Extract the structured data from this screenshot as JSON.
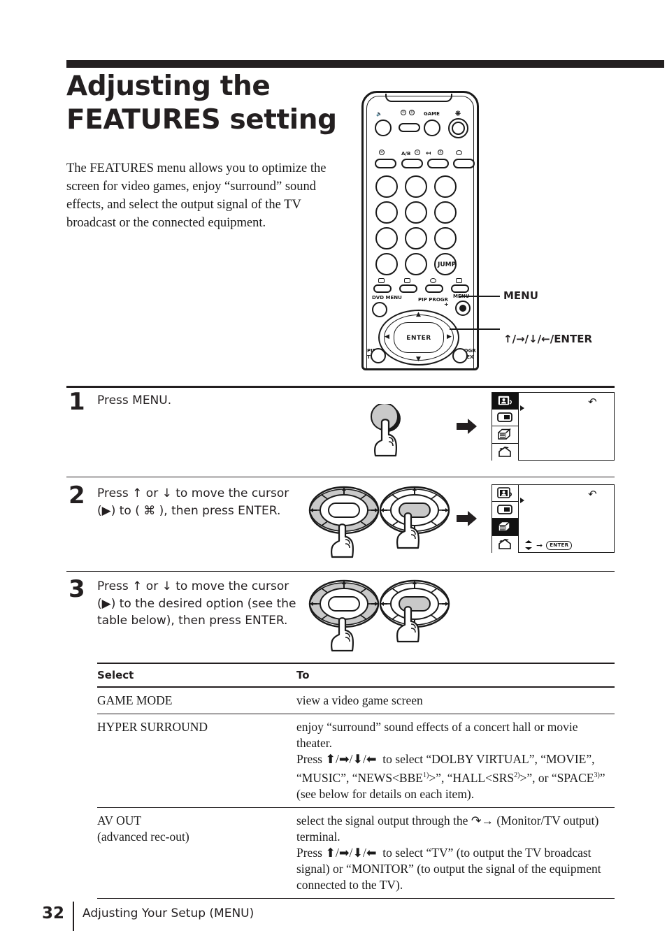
{
  "page": {
    "number": "32",
    "footer_section": "Adjusting Your Setup (MENU)"
  },
  "header": {
    "title_line1": "Adjusting the",
    "title_line2": "FEATURES setting",
    "intro": "The FEATURES menu allows you to optimize the screen for video games, enjoy “surround” sound effects, and select the output signal of the TV broadcast or the connected equipment."
  },
  "remote": {
    "labels": {
      "game": "GAME",
      "ab": "A/B",
      "dvd_menu": "DVD MENU",
      "pip_progr": "PIP PROGR",
      "menu": "MENU",
      "pip_text_1": "PIP",
      "pip_text_2": "TEXT",
      "progr_index_1": "PROGR",
      "progr_index_2": "INDEX",
      "jump": "JUMP",
      "enter": "ENTER",
      "plus": "+",
      "minus": "–"
    },
    "callouts": [
      {
        "name": "menu-callout",
        "text": "MENU"
      },
      {
        "name": "direction-enter-callout",
        "text": "↑/→/↓/←/ENTER"
      }
    ]
  },
  "steps": [
    {
      "number": "1",
      "text": "Press MENU."
    },
    {
      "number": "2",
      "text_parts": [
        "Press ",
        " or ",
        " to move the cursor (",
        ") to (",
        "),  then press ENTER."
      ],
      "text_plain": "Press ↑ or ↓ to move the cursor (▶) to ( ⌘ ),  then press ENTER."
    },
    {
      "number": "3",
      "text_plain": "Press ↑ or ↓ to move the cursor (▶) to the desired option (see the table below), then press ENTER."
    }
  ],
  "osd": {
    "hint_enter": "ENTER",
    "icons": [
      "picture-person-icon",
      "pip-screen-icon",
      "features-cube-icon",
      "setup-house-icon"
    ],
    "step1_selected_index": 0,
    "step2_selected_index": 2
  },
  "table": {
    "headers": [
      "Select",
      "To"
    ],
    "rows": [
      {
        "select": "GAME MODE",
        "select_sub": "",
        "to_lines": [
          "view a video game screen"
        ]
      },
      {
        "select": "HYPER SURROUND",
        "select_sub": "",
        "to_lines": [
          "enjoy “surround” sound effects of a concert hall or movie theater.",
          "Press ↑/→/↓/←  to select “DOLBY VIRTUAL”, “MOVIE”, “MUSIC”, “NEWS<BBE1)>”, “HALL<SRS2)>”, or “SPACE3)” (see below for details on each item)."
        ]
      },
      {
        "select": "AV OUT",
        "select_sub": "(advanced rec-out)",
        "to_lines": [
          "select the signal output through the ↦ (Monitor/TV output) terminal.",
          "Press ↑/→/↓/←  to select “TV” (to output the TV broadcast signal) or “MONITOR” (to output the signal of the equipment connected to the TV)."
        ]
      }
    ]
  },
  "colors": {
    "ink": "#231f20",
    "paper": "#ffffff",
    "button_fill": "#c9c9c9"
  }
}
